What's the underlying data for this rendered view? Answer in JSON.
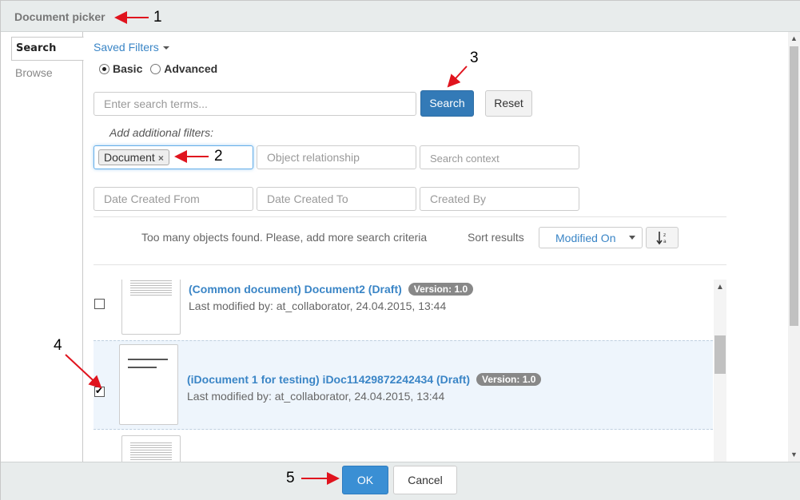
{
  "dialog": {
    "title": "Document picker"
  },
  "sidebar": {
    "tabs": [
      {
        "label": "Search",
        "active": true
      },
      {
        "label": "Browse",
        "active": false
      }
    ]
  },
  "search": {
    "saved_filters_label": "Saved Filters",
    "mode_options": [
      {
        "label": "Basic",
        "selected": true
      },
      {
        "label": "Advanced",
        "selected": false
      }
    ],
    "terms_placeholder": "Enter search terms...",
    "search_button": "Search",
    "reset_button": "Reset",
    "additional_filters_label": "Add additional filters:",
    "type_tag": "Document",
    "object_relationship_placeholder": "Object relationship",
    "search_context_placeholder": "Search context",
    "date_created_from_placeholder": "Date Created From",
    "date_created_to_placeholder": "Date Created To",
    "created_by_placeholder": "Created By"
  },
  "results_bar": {
    "message": "Too many objects found. Please, add more search criteria",
    "sort_label": "Sort results",
    "sort_value": "Modified On"
  },
  "results": [
    {
      "title": "(Common document) Document2 (Draft)",
      "version": "Version: 1.0",
      "meta": "Last modified by: at_collaborator, 24.04.2015, 13:44",
      "checked": false
    },
    {
      "title": "(iDocument 1 for testing) iDoc11429872242434 (Draft)",
      "version": "Version: 1.0",
      "meta": "Last modified by: at_collaborator, 24.04.2015, 13:44",
      "checked": true
    }
  ],
  "footer": {
    "ok_button": "OK",
    "cancel_button": "Cancel"
  },
  "annotations": {
    "n1": "1",
    "n2": "2",
    "n3": "3",
    "n4": "4",
    "n5": "5"
  },
  "colors": {
    "primary": "#337ab7",
    "link": "#3a85c6",
    "annotation_arrow": "#e0141e",
    "header_bg": "#e8ecec",
    "selected_row": "#eef5fc"
  }
}
